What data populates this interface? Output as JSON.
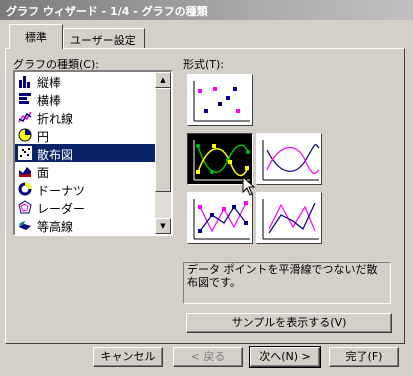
{
  "window": {
    "title": "グラフ ウィザード - 1/4 - グラフの種類"
  },
  "tabs": [
    {
      "label": "標準"
    },
    {
      "label": "ユーザー設定"
    }
  ],
  "chart_types": {
    "label": "グラフの種類(C):",
    "items": [
      {
        "label": "縦棒",
        "icon": "column-chart-icon"
      },
      {
        "label": "横棒",
        "icon": "bar-chart-icon"
      },
      {
        "label": "折れ線",
        "icon": "line-chart-icon"
      },
      {
        "label": "円",
        "icon": "pie-chart-icon"
      },
      {
        "label": "散布図",
        "icon": "scatter-chart-icon",
        "selected": true
      },
      {
        "label": "面",
        "icon": "area-chart-icon"
      },
      {
        "label": "ドーナツ",
        "icon": "doughnut-chart-icon"
      },
      {
        "label": "レーダー",
        "icon": "radar-chart-icon"
      },
      {
        "label": "等高線",
        "icon": "surface-chart-icon"
      }
    ]
  },
  "subtypes": {
    "label": "形式(T):",
    "selected_index": 1
  },
  "description": "データ ポイントを平滑線でつないだ散布図です。",
  "buttons": {
    "preview": "サンプルを表示する(V)",
    "cancel": "キャンセル",
    "back": "< 戻る",
    "next": "次へ(N) >",
    "finish": "完了(F)"
  },
  "colors": {
    "selection": "#0a246a",
    "marker_blue": "#00008b",
    "marker_magenta": "#ff00ff",
    "marker_yellow": "#ffff00",
    "series_green": "#00c000"
  }
}
